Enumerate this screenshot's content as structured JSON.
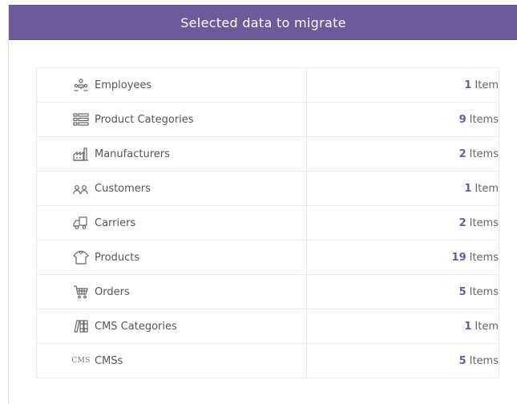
{
  "header": {
    "title": "Selected data to migrate"
  },
  "rows": [
    {
      "icon": "employees-icon",
      "label": "Employees",
      "count": "1",
      "unit": "Item"
    },
    {
      "icon": "product-categories-icon",
      "label": "Product Categories",
      "count": "9",
      "unit": "Items"
    },
    {
      "icon": "manufacturers-icon",
      "label": "Manufacturers",
      "count": "2",
      "unit": "Items"
    },
    {
      "icon": "customers-icon",
      "label": "Customers",
      "count": "1",
      "unit": "Item"
    },
    {
      "icon": "carriers-icon",
      "label": "Carriers",
      "count": "2",
      "unit": "Items"
    },
    {
      "icon": "products-icon",
      "label": "Products",
      "count": "19",
      "unit": "Items"
    },
    {
      "icon": "orders-icon",
      "label": "Orders",
      "count": "5",
      "unit": "Items"
    },
    {
      "icon": "cms-categories-icon",
      "label": "CMS Categories",
      "count": "1",
      "unit": "Item"
    },
    {
      "icon": "cms-icon",
      "label": "CMSs",
      "count": "5",
      "unit": "Items",
      "icon_text": "CMS"
    }
  ]
}
